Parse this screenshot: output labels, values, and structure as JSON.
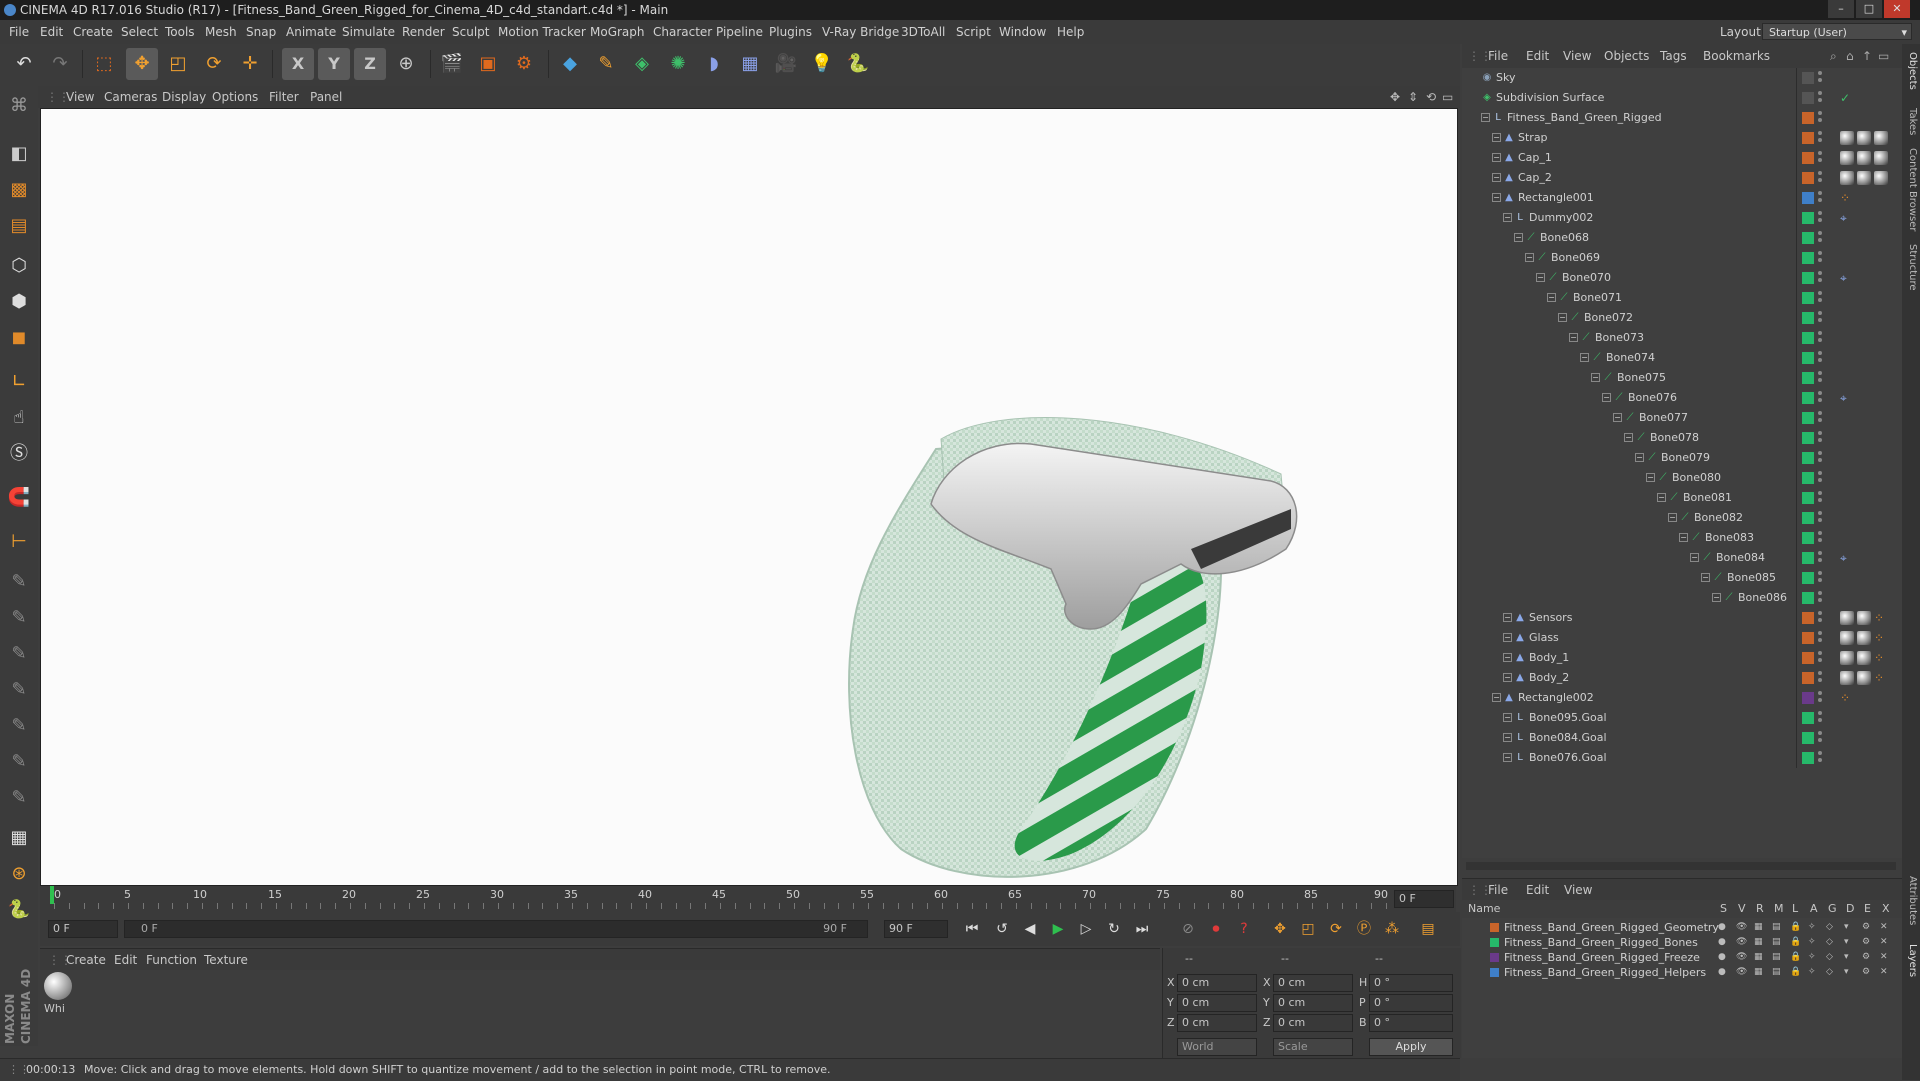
{
  "window": {
    "title": "CINEMA 4D R17.016 Studio (R17) - [Fitness_Band_Green_Rigged_for_Cinema_4D_c4d_standart.c4d *] - Main",
    "controls": [
      "–",
      "□",
      "✕"
    ]
  },
  "menubar": {
    "items": [
      "File",
      "Edit",
      "Create",
      "Select",
      "Tools",
      "Mesh",
      "Snap",
      "Animate",
      "Simulate",
      "Render",
      "Sculpt",
      "Motion Tracker",
      "MoGraph",
      "Character",
      "Pipeline",
      "Plugins",
      "V-Ray Bridge",
      "3DToAll",
      "Script",
      "Window",
      "Help"
    ],
    "layout_label": "Layout:",
    "layout_value": "Startup (User)"
  },
  "toolbar": {
    "axis_x": "X",
    "axis_y": "Y",
    "axis_z": "Z"
  },
  "viewport": {
    "menu": [
      "View",
      "Cameras",
      "Display",
      "Options",
      "Filter",
      "Panel"
    ]
  },
  "timeline": {
    "ticks": [
      "0",
      "5",
      "10",
      "15",
      "20",
      "25",
      "30",
      "35",
      "40",
      "45",
      "50",
      "55",
      "60",
      "65",
      "70",
      "75",
      "80",
      "85",
      "90"
    ],
    "current_frame": "0 F",
    "start_frame": "0 F",
    "min_field": "0 F",
    "max_field": "90 F",
    "end_frame": "90 F"
  },
  "material_manager": {
    "menu": [
      "Create",
      "Edit",
      "Function",
      "Texture"
    ],
    "material_label": "Whi"
  },
  "coordinates": {
    "header": [
      "--",
      "--",
      "--"
    ],
    "rows": [
      {
        "axis": "X",
        "pos": "0 cm",
        "axis2": "X",
        "size": "0 cm",
        "rot_label": "H",
        "rot": "0 °"
      },
      {
        "axis": "Y",
        "pos": "0 cm",
        "axis2": "Y",
        "size": "0 cm",
        "rot_label": "P",
        "rot": "0 °"
      },
      {
        "axis": "Z",
        "pos": "0 cm",
        "axis2": "Z",
        "size": "0 cm",
        "rot_label": "B",
        "rot": "0 °"
      }
    ],
    "mode1": "World",
    "mode2": "Scale",
    "apply_label": "Apply"
  },
  "status": {
    "time": "00:00:13",
    "message": "Move: Click and drag to move elements. Hold down SHIFT to quantize movement / add to the selection in point mode, CTRL to remove."
  },
  "object_manager": {
    "menu": [
      "File",
      "Edit",
      "View",
      "Objects",
      "Tags",
      "Bookmarks"
    ],
    "objects": [
      {
        "name": "Sky",
        "depth": 0,
        "icon": "sky",
        "layer": "#555555",
        "tags": []
      },
      {
        "name": "Subdivision Surface",
        "depth": 0,
        "icon": "subdiv",
        "layer": "#555555",
        "tags": [
          "check"
        ]
      },
      {
        "name": "Fitness_Band_Green_Rigged",
        "depth": 1,
        "icon": "null",
        "layer": "#c8642a",
        "tags": []
      },
      {
        "name": "Strap",
        "depth": 2,
        "icon": "poly",
        "layer": "#c8642a",
        "tags": [
          "mat",
          "mat",
          "mat"
        ]
      },
      {
        "name": "Cap_1",
        "depth": 2,
        "icon": "poly",
        "layer": "#c8642a",
        "tags": [
          "mat",
          "mat",
          "mat"
        ]
      },
      {
        "name": "Cap_2",
        "depth": 2,
        "icon": "poly",
        "layer": "#c8642a",
        "tags": [
          "mat",
          "mat",
          "mat"
        ]
      },
      {
        "name": "Rectangle001",
        "depth": 2,
        "icon": "poly",
        "layer": "#3f7fc8",
        "tags": [
          "dots"
        ]
      },
      {
        "name": "Dummy002",
        "depth": 3,
        "icon": "null",
        "layer": "#26b86a",
        "tags": [
          "ik"
        ]
      },
      {
        "name": "Bone068",
        "depth": 4,
        "icon": "bone",
        "layer": "#26b86a",
        "tags": []
      },
      {
        "name": "Bone069",
        "depth": 5,
        "icon": "bone",
        "layer": "#26b86a",
        "tags": []
      },
      {
        "name": "Bone070",
        "depth": 6,
        "icon": "bone",
        "layer": "#26b86a",
        "tags": [
          "ik"
        ]
      },
      {
        "name": "Bone071",
        "depth": 7,
        "icon": "bone",
        "layer": "#26b86a",
        "tags": []
      },
      {
        "name": "Bone072",
        "depth": 8,
        "icon": "bone",
        "layer": "#26b86a",
        "tags": []
      },
      {
        "name": "Bone073",
        "depth": 9,
        "icon": "bone",
        "layer": "#26b86a",
        "tags": []
      },
      {
        "name": "Bone074",
        "depth": 10,
        "icon": "bone",
        "layer": "#26b86a",
        "tags": []
      },
      {
        "name": "Bone075",
        "depth": 11,
        "icon": "bone",
        "layer": "#26b86a",
        "tags": []
      },
      {
        "name": "Bone076",
        "depth": 12,
        "icon": "bone",
        "layer": "#26b86a",
        "tags": [
          "ik"
        ]
      },
      {
        "name": "Bone077",
        "depth": 13,
        "icon": "bone",
        "layer": "#26b86a",
        "tags": []
      },
      {
        "name": "Bone078",
        "depth": 14,
        "icon": "bone",
        "layer": "#26b86a",
        "tags": []
      },
      {
        "name": "Bone079",
        "depth": 15,
        "icon": "bone",
        "layer": "#26b86a",
        "tags": []
      },
      {
        "name": "Bone080",
        "depth": 16,
        "icon": "bone",
        "layer": "#26b86a",
        "tags": []
      },
      {
        "name": "Bone081",
        "depth": 17,
        "icon": "bone",
        "layer": "#26b86a",
        "tags": []
      },
      {
        "name": "Bone082",
        "depth": 18,
        "icon": "bone",
        "layer": "#26b86a",
        "tags": []
      },
      {
        "name": "Bone083",
        "depth": 19,
        "icon": "bone",
        "layer": "#26b86a",
        "tags": []
      },
      {
        "name": "Bone084",
        "depth": 20,
        "icon": "bone",
        "layer": "#26b86a",
        "tags": [
          "ik"
        ]
      },
      {
        "name": "Bone085",
        "depth": 21,
        "icon": "bone",
        "layer": "#26b86a",
        "tags": []
      },
      {
        "name": "Bone086",
        "depth": 22,
        "icon": "bone",
        "layer": "#26b86a",
        "tags": []
      },
      {
        "name": "Sensors",
        "depth": 3,
        "icon": "poly",
        "layer": "#c8642a",
        "tags": [
          "mat",
          "mat",
          "dots"
        ]
      },
      {
        "name": "Glass",
        "depth": 3,
        "icon": "poly",
        "layer": "#c8642a",
        "tags": [
          "mat",
          "mat",
          "dots"
        ]
      },
      {
        "name": "Body_1",
        "depth": 3,
        "icon": "poly",
        "layer": "#c8642a",
        "tags": [
          "mat",
          "mat",
          "dots"
        ]
      },
      {
        "name": "Body_2",
        "depth": 3,
        "icon": "poly",
        "layer": "#c8642a",
        "tags": [
          "mat",
          "mat",
          "dots"
        ]
      },
      {
        "name": "Rectangle002",
        "depth": 2,
        "icon": "poly",
        "layer": "#6a3a8a",
        "tags": [
          "dots"
        ]
      },
      {
        "name": "Bone095.Goal",
        "depth": 3,
        "icon": "null",
        "layer": "#26b86a",
        "tags": []
      },
      {
        "name": "Bone084.Goal",
        "depth": 3,
        "icon": "null",
        "layer": "#26b86a",
        "tags": []
      },
      {
        "name": "Bone076.Goal",
        "depth": 3,
        "icon": "null",
        "layer": "#26b86a",
        "tags": []
      }
    ]
  },
  "layer_manager": {
    "menu": [
      "File",
      "Edit",
      "View"
    ],
    "columns": [
      "Name",
      "S",
      "V",
      "R",
      "M",
      "L",
      "A",
      "G",
      "D",
      "E",
      "X"
    ],
    "layers": [
      {
        "name": "Fitness_Band_Green_Rigged_Geometry",
        "color": "#c8642a"
      },
      {
        "name": "Fitness_Band_Green_Rigged_Bones",
        "color": "#26b86a"
      },
      {
        "name": "Fitness_Band_Green_Rigged_Freeze",
        "color": "#6a3a8a"
      },
      {
        "name": "Fitness_Band_Green_Rigged_Helpers",
        "color": "#3f7fc8"
      }
    ]
  },
  "side_tabs": [
    "Objects",
    "Takes",
    "Content Browser",
    "Structure",
    "Attributes",
    "Layers"
  ],
  "branding": {
    "line1": "MAXON",
    "line2": "CINEMA 4D"
  }
}
